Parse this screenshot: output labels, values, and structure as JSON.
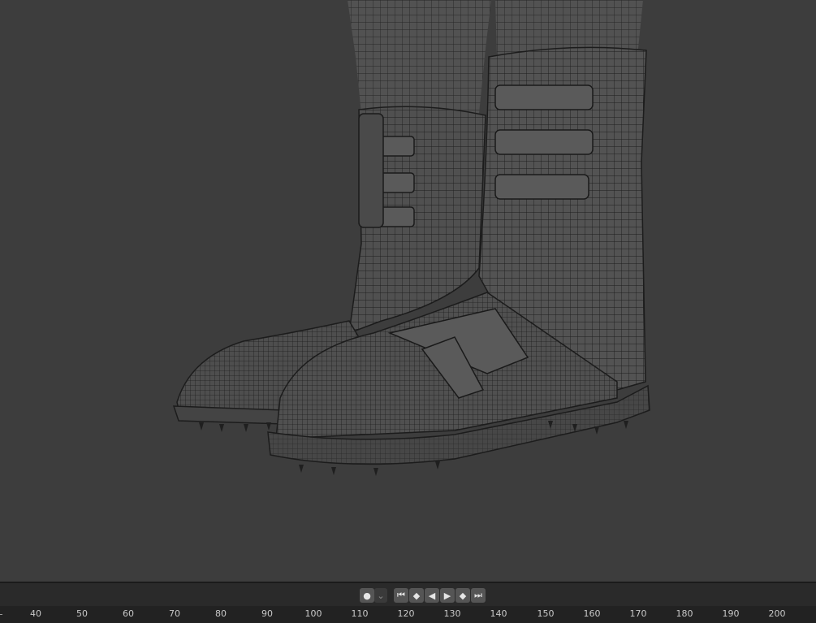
{
  "viewport": {
    "subject": "boots-wireframe-mesh"
  },
  "timeline": {
    "keyframe_toggle_icon": "record-dot-icon",
    "keyframe_dropdown_icon": "chevron-down-icon",
    "playback_icons": [
      "jump-to-start-icon",
      "jump-to-prev-keyframe-icon",
      "play-reverse-icon",
      "play-icon",
      "jump-to-next-keyframe-icon",
      "jump-to-end-icon"
    ],
    "ruler_labels": [
      "40",
      "50",
      "60",
      "70",
      "80",
      "90",
      "100",
      "110",
      "120",
      "130",
      "140",
      "150",
      "160",
      "170",
      "180",
      "190",
      "200"
    ]
  },
  "colors": {
    "viewport_bg": "#3d3d3d",
    "mesh_line": "#1e1e1e",
    "timeline_bg": "#2a2a2a"
  }
}
